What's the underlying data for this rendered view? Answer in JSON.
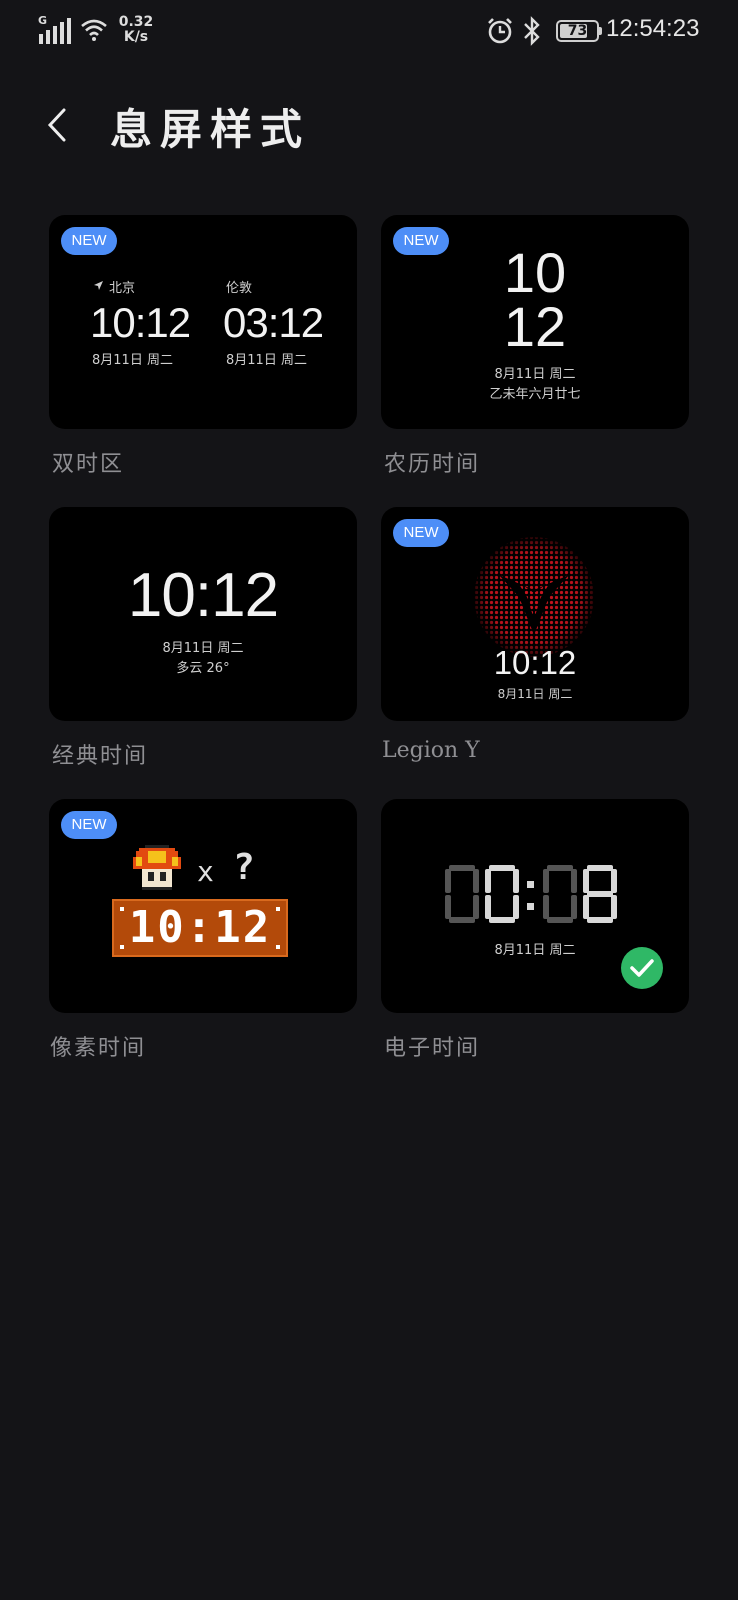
{
  "status_bar": {
    "network_type": "G",
    "speed_value": "0.32",
    "speed_unit": "K/s",
    "battery": "73",
    "time": "12:54:23"
  },
  "header": {
    "title": "息屏样式",
    "back_icon": "chevron-left-icon"
  },
  "badge_text": "NEW",
  "styles": [
    {
      "label": "双时区",
      "new": true,
      "city1": "北京",
      "time1": "10:12",
      "date1": "8月11日 周二",
      "city2": "伦敦",
      "time2": "03:12",
      "date2": "8月11日 周二"
    },
    {
      "label": "农历时间",
      "new": true,
      "hour": "10",
      "minute": "12",
      "date": "8月11日 周二",
      "lunar": "乙未年六月廿七"
    },
    {
      "label": "经典时间",
      "new": false,
      "time": "10:12",
      "date": "8月11日 周二",
      "weather": "多云 26°"
    },
    {
      "label": "Legion Y",
      "new": true,
      "time": "10:12",
      "date": "8月11日 周二"
    },
    {
      "label": "像素时间",
      "new": true,
      "x": "x",
      "question": "?",
      "time": "10:12"
    },
    {
      "label": "电子时间",
      "new": false,
      "time": "00:08",
      "date": "8月11日 周二",
      "selected": true
    }
  ],
  "colors": {
    "background": "#141417",
    "card": "#000000",
    "badge": "#4d8ef7",
    "selected_check": "#2fb866",
    "legion_red": "#c8141e"
  }
}
